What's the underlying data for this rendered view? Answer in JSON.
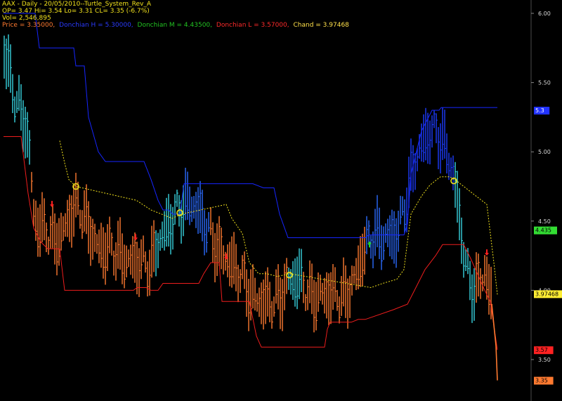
{
  "header": {
    "title": "AAX - Daily - 20/05/2010--Turtle_System_Rev_A",
    "ohlc": "OP= 3.47 Hi= 3.54 Lo= 3.31 CL= 3.35 (-6.7%)",
    "vol": "Vol= 2,546,895",
    "legend": [
      {
        "text": "Price = 3.35000,",
        "color": "#ff7a30"
      },
      {
        "text": "Donchian H = 5.30000,",
        "color": "#2a3bff"
      },
      {
        "text": "Donchian M = 4.43500,",
        "color": "#22c322"
      },
      {
        "text": "Donchian L = 3.57000,",
        "color": "#ff2a2a"
      },
      {
        "text": "Chand = 3.97468",
        "color": "#ffe04a"
      }
    ]
  },
  "chart_data": {
    "type": "line",
    "y_ticks": [
      "6.00",
      "5.50",
      "5.00",
      "4.50",
      "4.00",
      "3.50"
    ],
    "ylim": [
      3.3,
      6.05
    ],
    "value_badges": [
      {
        "label": "5.3",
        "bg": "#2233ff",
        "fg": "#ffffff"
      },
      {
        "label": "4.435",
        "bg": "#33dd33",
        "fg": "#000000"
      },
      {
        "label": "3.97468",
        "bg": "#ffee33",
        "fg": "#000000"
      },
      {
        "label": "3.57",
        "bg": "#ff2222",
        "fg": "#000000"
      },
      {
        "label": "3.35",
        "bg": "#ff7a30",
        "fg": "#000000"
      }
    ],
    "series": [
      {
        "name": "Donchian H",
        "color": "#1626ff",
        "points": [
          [
            5,
            6.0
          ],
          [
            50,
            6.0
          ],
          [
            56,
            5.75
          ],
          [
            105,
            5.75
          ],
          [
            108,
            5.62
          ],
          [
            120,
            5.62
          ],
          [
            126,
            5.25
          ],
          [
            140,
            5.0
          ],
          [
            150,
            4.93
          ],
          [
            205,
            4.93
          ],
          [
            215,
            4.8
          ],
          [
            225,
            4.65
          ],
          [
            232,
            4.58
          ],
          [
            240,
            4.58
          ],
          [
            246,
            4.55
          ],
          [
            256,
            4.55
          ],
          [
            262,
            4.77
          ],
          [
            360,
            4.77
          ],
          [
            375,
            4.74
          ],
          [
            390,
            4.74
          ],
          [
            398,
            4.55
          ],
          [
            410,
            4.38
          ],
          [
            520,
            4.38
          ],
          [
            525,
            4.4
          ],
          [
            575,
            4.4
          ],
          [
            580,
            4.48
          ],
          [
            585,
            4.84
          ],
          [
            600,
            5.15
          ],
          [
            615,
            5.3
          ],
          [
            625,
            5.3
          ],
          [
            628,
            5.32
          ],
          [
            708,
            5.32
          ]
        ]
      },
      {
        "name": "Donchian L",
        "color": "#ee1d1d",
        "points": [
          [
            5,
            5.11
          ],
          [
            30,
            5.11
          ],
          [
            40,
            4.7
          ],
          [
            48,
            4.45
          ],
          [
            58,
            4.35
          ],
          [
            68,
            4.3
          ],
          [
            85,
            4.3
          ],
          [
            92,
            4.0
          ],
          [
            190,
            4.0
          ],
          [
            195,
            4.02
          ],
          [
            208,
            4.02
          ],
          [
            215,
            4.0
          ],
          [
            225,
            4.0
          ],
          [
            232,
            4.05
          ],
          [
            283,
            4.05
          ],
          [
            290,
            4.12
          ],
          [
            300,
            4.2
          ],
          [
            312,
            4.2
          ],
          [
            316,
            3.92
          ],
          [
            355,
            3.92
          ],
          [
            365,
            3.67
          ],
          [
            372,
            3.59
          ],
          [
            462,
            3.59
          ],
          [
            466,
            3.72
          ],
          [
            470,
            3.77
          ],
          [
            500,
            3.77
          ],
          [
            510,
            3.79
          ],
          [
            520,
            3.79
          ],
          [
            560,
            3.86
          ],
          [
            580,
            3.9
          ],
          [
            592,
            4.02
          ],
          [
            605,
            4.15
          ],
          [
            620,
            4.25
          ],
          [
            630,
            4.33
          ],
          [
            660,
            4.33
          ],
          [
            670,
            4.23
          ],
          [
            690,
            4.0
          ],
          [
            698,
            3.92
          ],
          [
            708,
            3.57
          ]
        ]
      },
      {
        "name": "Chand",
        "color": "#f2e21c",
        "dashed": true,
        "points": [
          [
            85,
            5.08
          ],
          [
            92,
            4.92
          ],
          [
            98,
            4.8
          ],
          [
            108,
            4.75
          ],
          [
            194,
            4.65
          ],
          [
            215,
            4.58
          ],
          [
            230,
            4.55
          ],
          [
            245,
            4.52
          ],
          [
            258,
            4.55
          ],
          [
            322,
            4.62
          ],
          [
            330,
            4.52
          ],
          [
            345,
            4.41
          ],
          [
            355,
            4.2
          ],
          [
            368,
            4.12
          ],
          [
            380,
            4.12
          ],
          [
            395,
            4.1
          ],
          [
            412,
            4.12
          ],
          [
            528,
            4.02
          ],
          [
            545,
            4.05
          ],
          [
            565,
            4.08
          ],
          [
            575,
            4.15
          ],
          [
            585,
            4.55
          ],
          [
            600,
            4.68
          ],
          [
            612,
            4.76
          ],
          [
            627,
            4.82
          ],
          [
            640,
            4.82
          ],
          [
            650,
            4.79
          ],
          [
            693,
            4.62
          ],
          [
            703,
            4.2
          ],
          [
            708,
            3.97
          ]
        ]
      },
      {
        "name": "Price",
        "color": "#ff7a30",
        "points": [
          [
            700,
            3.9
          ],
          [
            702,
            3.8
          ],
          [
            704,
            3.7
          ],
          [
            706,
            3.6
          ],
          [
            708,
            3.35
          ]
        ]
      }
    ],
    "circles": [
      [
        108,
        4.75
      ],
      [
        256,
        4.56
      ],
      [
        412,
        4.11
      ],
      [
        646,
        4.79
      ]
    ],
    "arrows_down": [
      [
        74,
        4.6
      ],
      [
        193,
        4.36
      ],
      [
        322,
        4.22
      ],
      [
        693,
        4.25
      ]
    ],
    "arrows_up": [
      [
        526,
        4.35
      ]
    ]
  }
}
